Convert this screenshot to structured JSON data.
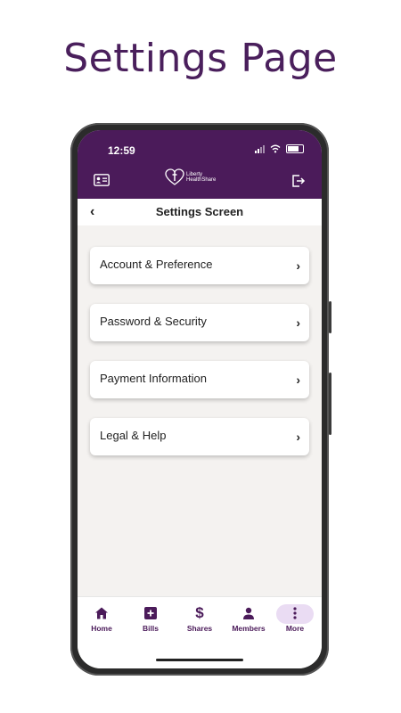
{
  "page_title": "Settings Page",
  "status_bar": {
    "time": "12:59"
  },
  "brand": {
    "line1": "Liberty",
    "line2": "HealthShare"
  },
  "header": {
    "back": "‹",
    "title": "Settings Screen"
  },
  "menu": [
    {
      "label": "Account & Preference",
      "chevron": "›"
    },
    {
      "label": "Password & Security",
      "chevron": "›"
    },
    {
      "label": "Payment Information",
      "chevron": "›"
    },
    {
      "label": "Legal & Help",
      "chevron": "›"
    }
  ],
  "bottom_nav": [
    {
      "label": "Home",
      "icon": "home-icon"
    },
    {
      "label": "Bills",
      "icon": "plus-square-icon"
    },
    {
      "label": "Shares",
      "icon": "dollar-icon",
      "glyph": "$"
    },
    {
      "label": "Members",
      "icon": "person-icon"
    },
    {
      "label": "More",
      "icon": "more-vertical-icon",
      "selected": true
    }
  ],
  "colors": {
    "brand_purple": "#4b1b5a",
    "selected_pill": "#eadcf3",
    "screen_bg": "#f4f2f0"
  }
}
